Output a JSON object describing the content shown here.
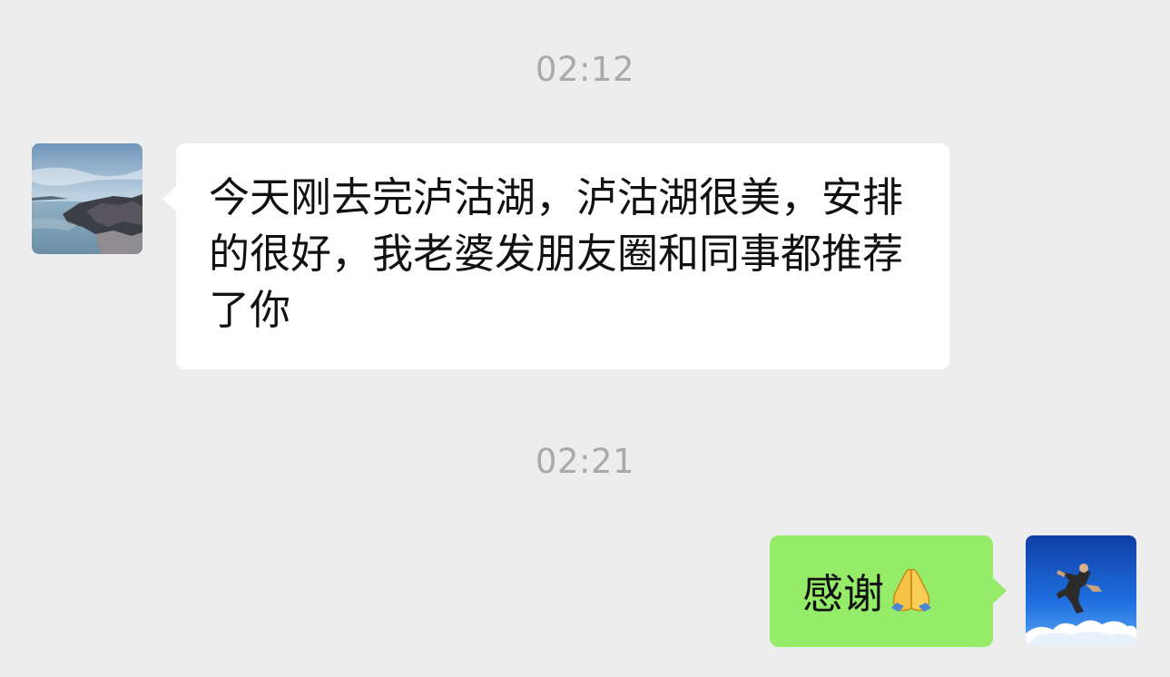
{
  "chat": {
    "messages": [
      {
        "timestamp": "02:12",
        "direction": "incoming",
        "text": "今天刚去完泸沽湖，泸沽湖很美，安排的很好，我老婆发朋友圈和同事都推荐了你"
      },
      {
        "timestamp": "02:21",
        "direction": "outgoing",
        "text": "感谢",
        "emoji": "folded-hands-icon"
      }
    ]
  },
  "colors": {
    "background": "#ededed",
    "incoming_bubble": "#ffffff",
    "outgoing_bubble": "#95ec69",
    "timestamp_text": "#a9a9a9"
  }
}
